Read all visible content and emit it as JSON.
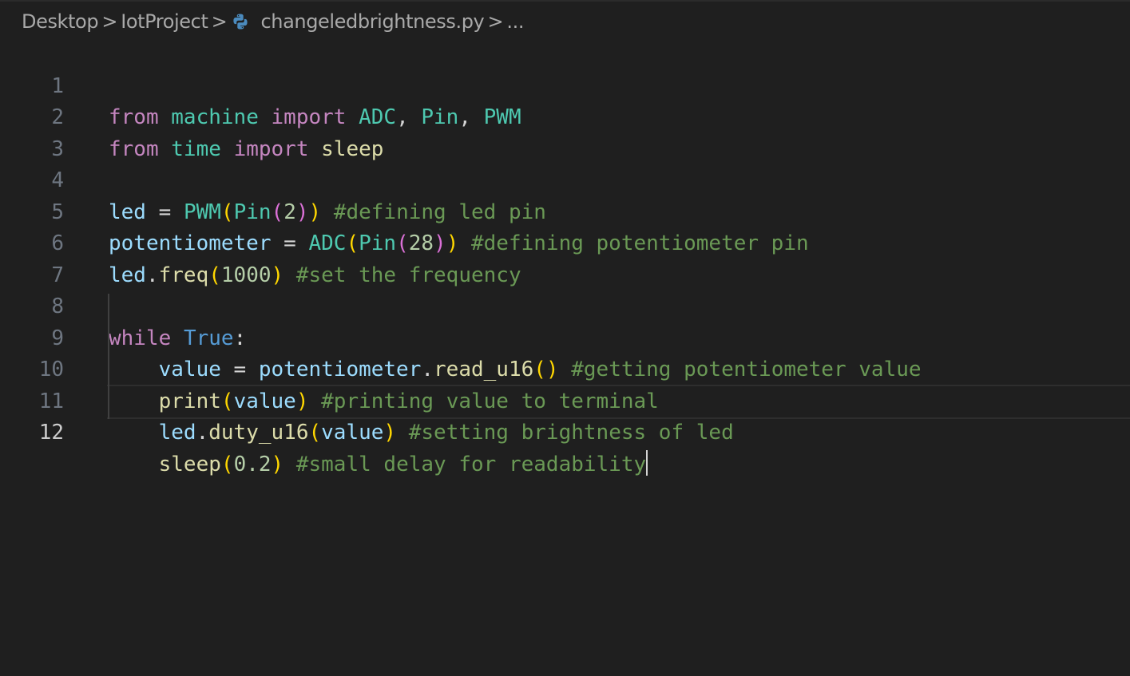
{
  "breadcrumb": {
    "items": [
      "Desktop",
      "IotProject",
      "changeledbrightness.py",
      "..."
    ],
    "separator": ">"
  },
  "editor": {
    "current_line": 12,
    "line_numbers": [
      "1",
      "2",
      "3",
      "4",
      "5",
      "6",
      "7",
      "8",
      "9",
      "10",
      "11",
      "12"
    ],
    "tokens": {
      "from": "from",
      "import": "import",
      "machine": "machine",
      "time": "time",
      "ADC": "ADC",
      "Pin": "Pin",
      "PWM": "PWM",
      "sleep": "sleep",
      "led": "led",
      "potentiometer": "potentiometer",
      "freq": "freq",
      "while": "while",
      "True": "True",
      "value": "value",
      "read_u16": "read_u16",
      "print": "print",
      "duty_u16": "duty_u16",
      "n2": "2",
      "n28": "28",
      "n1000": "1000",
      "n02": "0.2"
    },
    "comments": {
      "line4": "#defining led pin",
      "line5": "#defining potentiometer pin",
      "line6": "#set the frequency",
      "line9": "#getting potentiometer value",
      "line10": "#printing value to terminal",
      "line11": "#setting brightness of led",
      "line12": "#small delay for readability"
    }
  },
  "colors": {
    "background": "#1f1f1f",
    "keyword": "#c586c0",
    "class": "#4ec9b0",
    "variable": "#9cdcfe",
    "function": "#dcdcaa",
    "number": "#b5cea8",
    "comment": "#6a9955",
    "bracket_gold": "#ffd700",
    "bracket_orchid": "#da70d6"
  }
}
